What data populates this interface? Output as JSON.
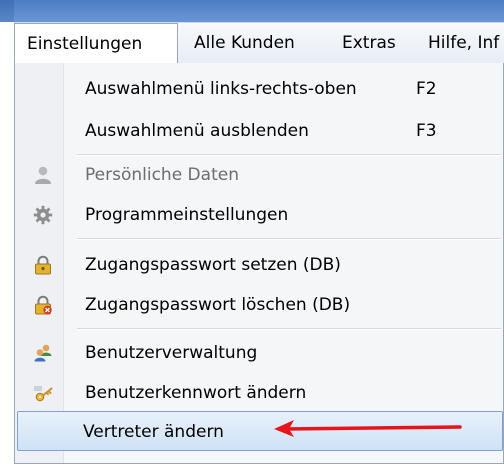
{
  "menubar": {
    "items": [
      {
        "label": "Einstellungen",
        "active": true
      },
      {
        "label": "Alle Kunden"
      },
      {
        "label": "Extras"
      },
      {
        "label": "Hilfe, Inf"
      }
    ]
  },
  "menu": {
    "items": [
      {
        "label": "Auswahlmenü links-rechts-oben",
        "shortcut": "F2"
      },
      {
        "label": "Auswahlmenü ausblenden",
        "shortcut": "F3"
      },
      {
        "label": "Persönliche Daten",
        "icon": "person-icon",
        "disabled": true
      },
      {
        "label": "Programmeinstellungen",
        "icon": "gear-icon"
      },
      {
        "label": "Zugangspasswort setzen (DB)",
        "icon": "lock-icon"
      },
      {
        "label": "Zugangspasswort löschen (DB)",
        "icon": "lock-delete-icon"
      },
      {
        "label": "Benutzerverwaltung",
        "icon": "users-icon"
      },
      {
        "label": "Benutzerkennwort ändern",
        "icon": "key-icon"
      },
      {
        "label": "Vertreter ändern",
        "selected": true
      }
    ]
  },
  "colors": {
    "annotation_arrow": "#e8141c",
    "selection_border": "#7da2ce"
  }
}
